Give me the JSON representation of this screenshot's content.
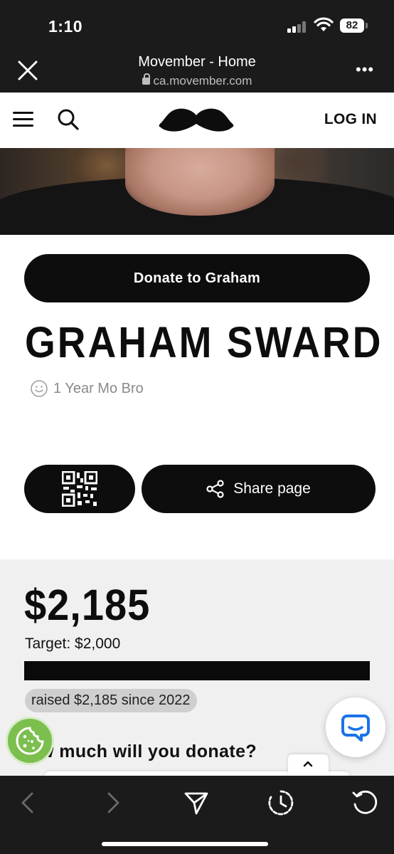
{
  "status_bar": {
    "time": "1:10",
    "battery": "82"
  },
  "browser": {
    "title": "Movember - Home",
    "url": "ca.movember.com",
    "more_label": "•••"
  },
  "site_header": {
    "login_label": "LOG IN"
  },
  "profile": {
    "donate_label": "Donate to Graham",
    "name": "GRAHAM SWARD",
    "badge": "1 Year Mo Bro",
    "share_label": "Share page"
  },
  "stats": {
    "amount": "$2,185",
    "target": "Target: $2,000",
    "progress_fraction": 1.0,
    "raised": "raised $2,185 since 2022",
    "question": "w much will you donate?"
  },
  "colors": {
    "brand_black": "#0d0d0d",
    "cookie_green": "#7cbf4e",
    "chat_blue": "#1a73e8"
  },
  "icons": [
    "close-icon",
    "lock-icon",
    "more-icon",
    "menu-icon",
    "search-icon",
    "mustache-logo",
    "smiley-icon",
    "qr-code-icon",
    "share-icon",
    "chevron-up-icon",
    "cookie-icon",
    "chat-icon",
    "back-icon",
    "forward-icon",
    "send-icon",
    "history-icon",
    "reload-icon"
  ]
}
